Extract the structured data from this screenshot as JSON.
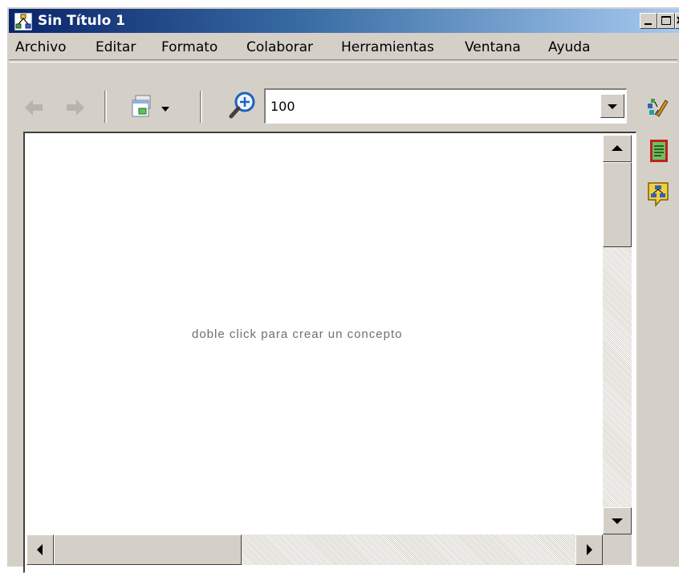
{
  "window": {
    "title": "Sin Título 1",
    "app_icon": "cmap-icon",
    "controls": [
      "minimize-icon",
      "maximize-icon",
      "close-icon"
    ]
  },
  "menu": {
    "items": [
      {
        "label": "Archivo"
      },
      {
        "label": "Editar"
      },
      {
        "label": "Formato"
      },
      {
        "label": "Colaborar"
      },
      {
        "label": "Herramientas"
      },
      {
        "label": "Ventana"
      },
      {
        "label": "Ayuda"
      }
    ]
  },
  "toolbar": {
    "back_icon": "back-arrow-icon",
    "forward_icon": "forward-arrow-icon",
    "views_icon": "views-dropdown-icon",
    "zoom_icon": "zoom-in-icon",
    "zoom_value": "100"
  },
  "canvas": {
    "hint": "doble click para crear un concepto"
  },
  "side_panel": {
    "icons": [
      "styles-icon",
      "list-document-icon",
      "concept-map-bubble-icon"
    ]
  },
  "colors": {
    "title_bar_start": "#0a246a",
    "title_bar_end": "#a6caf0",
    "window_face": "#d4d0c8"
  }
}
